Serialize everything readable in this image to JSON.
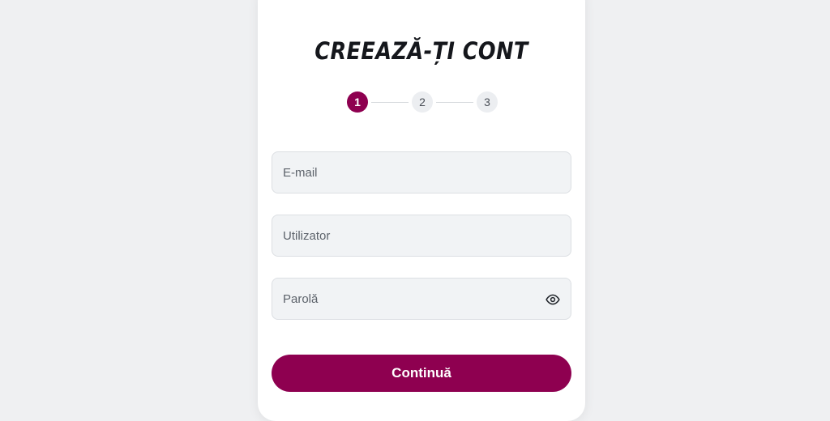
{
  "signup": {
    "title": "CREEAZĂ-ȚI CONT",
    "steps": [
      {
        "label": "1",
        "state": "active"
      },
      {
        "label": "2",
        "state": "inactive"
      },
      {
        "label": "3",
        "state": "inactive"
      }
    ],
    "fields": {
      "email": {
        "value": "",
        "placeholder": "E-mail"
      },
      "username": {
        "value": "",
        "placeholder": "Utilizator"
      },
      "password": {
        "value": "",
        "placeholder": "Parolă",
        "toggle_icon": "eye-icon"
      }
    },
    "continue_label": "Continuă"
  },
  "colors": {
    "accent": "#8e0050",
    "page_background": "#eff0f2",
    "card_background": "#ffffff",
    "field_background": "#f1f3f5"
  }
}
